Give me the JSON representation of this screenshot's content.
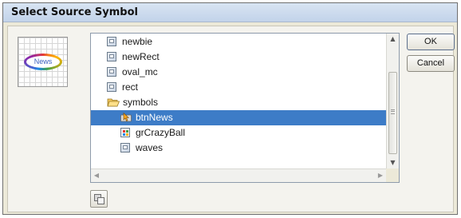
{
  "dialog": {
    "title": "Select Source Symbol"
  },
  "preview": {
    "button_text": "News"
  },
  "symbols": [
    {
      "name": "newbie",
      "icon": "movieclip-icon",
      "level": 0
    },
    {
      "name": "newRect",
      "icon": "movieclip-icon",
      "level": 0
    },
    {
      "name": "oval_mc",
      "icon": "movieclip-icon",
      "level": 0
    },
    {
      "name": "rect",
      "icon": "movieclip-icon",
      "level": 0
    },
    {
      "name": "symbols",
      "icon": "folder-open-icon",
      "level": 0
    },
    {
      "name": "btnNews",
      "icon": "button-symbol-icon",
      "level": 1,
      "selected": true
    },
    {
      "name": "grCrazyBall",
      "icon": "graphic-symbol-icon",
      "level": 1
    },
    {
      "name": "waves",
      "icon": "movieclip-icon",
      "level": 1
    }
  ],
  "buttons": {
    "ok": "OK",
    "cancel": "Cancel"
  },
  "toolbar": {
    "duplicate_icon": "duplicate-symbol-icon"
  },
  "colors": {
    "selection": "#3d7cc7",
    "dialog_bg": "#ece9d8"
  }
}
